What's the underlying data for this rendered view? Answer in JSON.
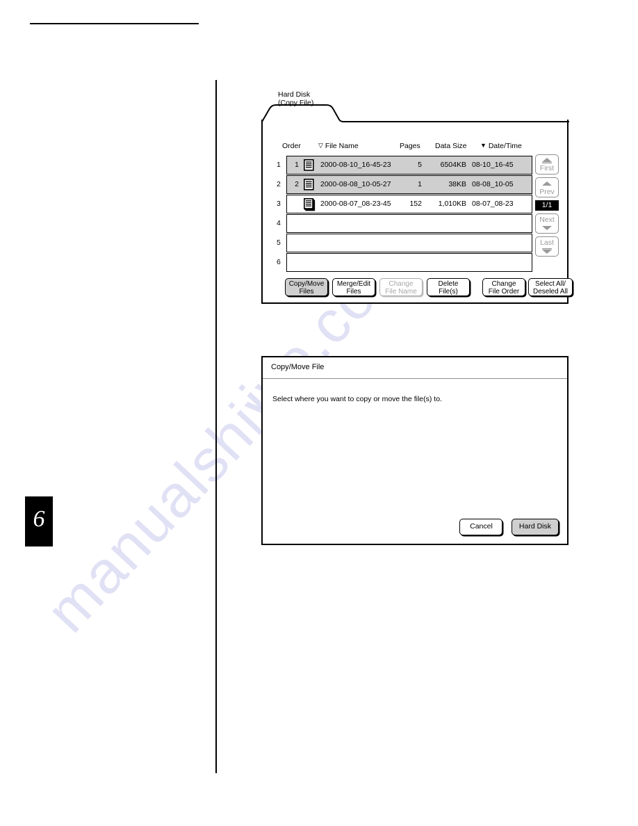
{
  "page": {
    "chapter_number": "6"
  },
  "hard_disk_panel": {
    "tab_line1": "Hard Disk",
    "tab_line2": "(Copy File)",
    "columns": {
      "order": "Order",
      "file_name": "File Name",
      "pages": "Pages",
      "data_size": "Data Size",
      "date_time": "Date/Time",
      "file_name_sort_glyph": "▽",
      "date_time_sort_glyph": "▼"
    },
    "rows": [
      {
        "index": "1",
        "order": "1",
        "icon": "document-icon",
        "file_name": "2000-08-10_16-45-23",
        "pages": "5",
        "data_size": "6504KB",
        "date_time": "08-10_16-45",
        "selected": true
      },
      {
        "index": "2",
        "order": "2",
        "icon": "document-icon",
        "file_name": "2000-08-08_10-05-27",
        "pages": "1",
        "data_size": "38KB",
        "date_time": "08-08_10-05",
        "selected": true
      },
      {
        "index": "3",
        "order": "",
        "icon": "document-stack-icon",
        "file_name": "2000-08-07_08-23-45",
        "pages": "152",
        "data_size": "1,010KB",
        "date_time": "08-07_08-23",
        "selected": false
      },
      {
        "index": "4",
        "order": "",
        "icon": "",
        "file_name": "",
        "pages": "",
        "data_size": "",
        "date_time": "",
        "selected": false
      },
      {
        "index": "5",
        "order": "",
        "icon": "",
        "file_name": "",
        "pages": "",
        "data_size": "",
        "date_time": "",
        "selected": false
      },
      {
        "index": "6",
        "order": "",
        "icon": "",
        "file_name": "",
        "pages": "",
        "data_size": "",
        "date_time": "",
        "selected": false
      }
    ],
    "nav": {
      "first": "First",
      "prev": "Prev",
      "page_count": "1/1",
      "next": "Next",
      "last": "Last",
      "first_glyph": "⏫",
      "prev_glyph": "▲",
      "next_glyph": "▼",
      "last_glyph": "⏬"
    },
    "buttons": [
      {
        "line1": "Copy/Move",
        "line2": "Files",
        "state": "selected"
      },
      {
        "line1": "Merge/Edit",
        "line2": "Files",
        "state": "normal"
      },
      {
        "line1": "Change",
        "line2": "File Name",
        "state": "disabled"
      },
      {
        "line1": "Delete",
        "line2": "File(s)",
        "state": "normal"
      },
      {
        "line1": "Change",
        "line2": "File Order",
        "state": "normal"
      },
      {
        "line1": "Select All/",
        "line2": "Deseled All",
        "state": "normal"
      }
    ]
  },
  "copy_move_dialog": {
    "title": "Copy/Move File",
    "message": "Select where you want to copy or move the file(s) to.",
    "cancel_label": "Cancel",
    "hard_disk_label": "Hard Disk"
  },
  "watermark": {
    "line1": "manualshive",
    "line2": "ive.com"
  }
}
